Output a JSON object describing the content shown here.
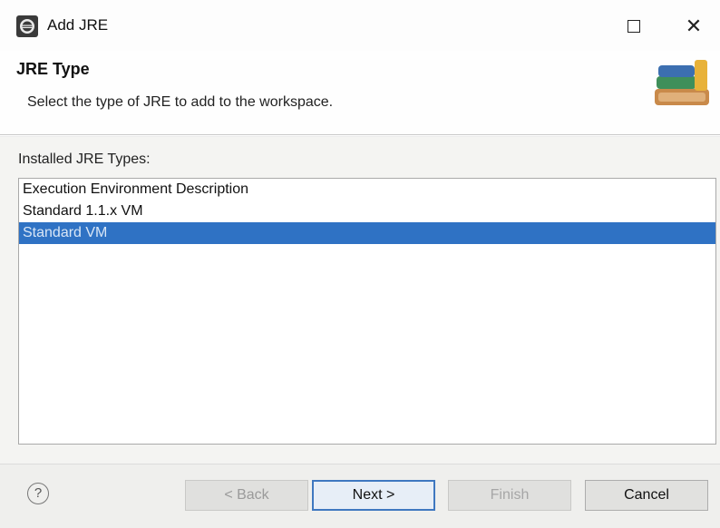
{
  "window": {
    "title": "Add JRE",
    "maximize_icon": "maximize-icon",
    "close_label": "✕"
  },
  "header": {
    "title": "JRE Type",
    "description": "Select the type of JRE to add to the workspace.",
    "art_icon": "jre-library-books-icon"
  },
  "content": {
    "list_label": "Installed JRE Types:",
    "items": [
      {
        "label": "Execution Environment Description",
        "selected": false
      },
      {
        "label": "Standard 1.1.x VM",
        "selected": false
      },
      {
        "label": "Standard VM",
        "selected": true
      }
    ]
  },
  "footer": {
    "help_label": "?",
    "back_label": "< Back",
    "next_label": "Next >",
    "finish_label": "Finish",
    "cancel_label": "Cancel"
  },
  "colors": {
    "selection": "#2f72c4",
    "default_button_border": "#3f78c0"
  }
}
